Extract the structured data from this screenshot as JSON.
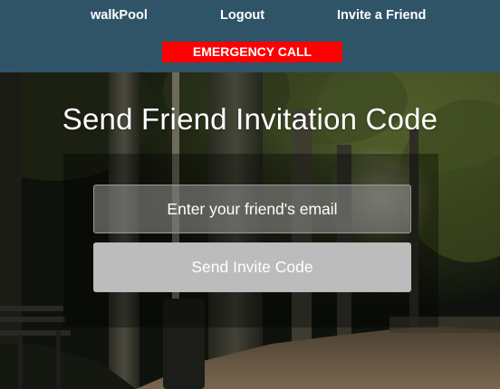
{
  "nav": {
    "brand": "walkPool",
    "logout": "Logout",
    "invite": "Invite a Friend"
  },
  "emergency": {
    "label": "EMERGENCY CALL",
    "color": "#ff0000"
  },
  "header": {
    "background_color": "#2f5468"
  },
  "invite_form": {
    "title": "Send Friend Invitation Code",
    "email_placeholder": "Enter your friend's email",
    "email_value": "",
    "submit_label": "Send Invite Code"
  },
  "background_image": {
    "subject": "park-path-at-night-photo"
  }
}
